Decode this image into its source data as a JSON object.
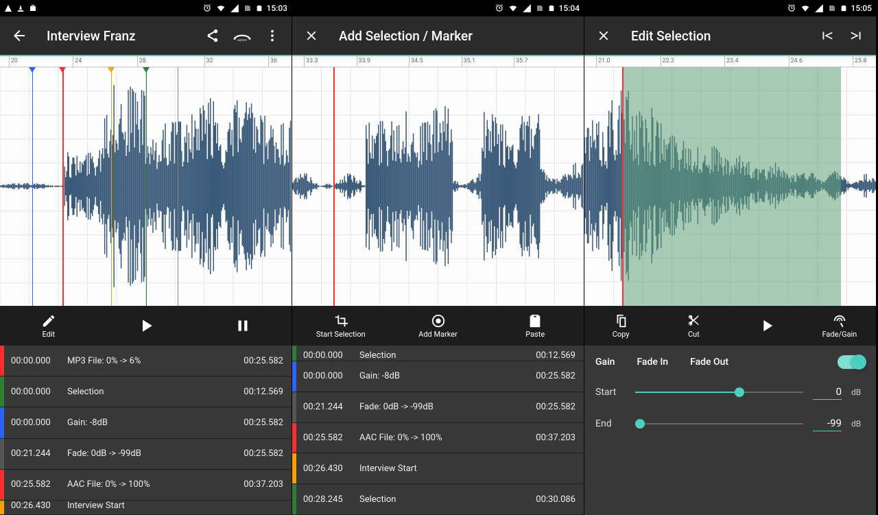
{
  "screens": [
    {
      "status": {
        "time": "15:03",
        "left_icons": [
          "antenna-icon",
          "vlc-icon",
          "bag-icon"
        ],
        "right_icons": [
          "alarm-icon",
          "wifi-icon",
          "signal-icon",
          "nosim-icon",
          "battery-icon"
        ]
      },
      "appbar": {
        "leading": "back-arrow",
        "title": "Interview Franz",
        "actions": [
          "share-icon",
          "auphonic-icon",
          "more-icon"
        ]
      },
      "ruler": {
        "ticks": [
          "20",
          "24",
          "28",
          "32",
          "36"
        ],
        "positions": [
          3,
          25,
          47,
          70,
          92
        ]
      },
      "waveform": {
        "playhead_pct": 21.5,
        "markers": [
          {
            "pct": 11,
            "color": "#2962ff"
          },
          {
            "pct": 21.5,
            "color": "#ff2d2d"
          },
          {
            "pct": 38,
            "color": "#ffa000"
          },
          {
            "pct": 50,
            "color": "#2e7d32"
          }
        ],
        "marker_lines": [
          {
            "pct": 11,
            "color": "#2962ff"
          },
          {
            "pct": 38,
            "color": "#ffa000"
          },
          {
            "pct": 50,
            "color": "#2e7d32"
          },
          {
            "pct": 61,
            "color": "#888"
          }
        ]
      },
      "toolbar": [
        {
          "icon": "pencil-icon",
          "label": "Edit",
          "name": "edit-button"
        },
        {
          "icon": "play-icon",
          "label": "",
          "name": "play-button"
        },
        {
          "icon": "pause-icon",
          "label": "",
          "name": "pause-button"
        }
      ],
      "list": [
        {
          "color": "#ff2d2d",
          "t1": "00:00.000",
          "desc": "MP3 File: 0% -> 6%",
          "t2": "00:25.582"
        },
        {
          "color": "#2e7d32",
          "t1": "00:00.000",
          "desc": "Selection",
          "t2": "00:12.569"
        },
        {
          "color": "#2962ff",
          "t1": "00:00.000",
          "desc": "Gain: -8dB",
          "t2": "00:25.582"
        },
        {
          "color": "#555",
          "t1": "00:21.244",
          "desc": "Fade: 0dB -> -99dB",
          "t2": "00:25.582"
        },
        {
          "color": "#ff2d2d",
          "t1": "00:25.582",
          "desc": "AAC File: 0% -> 100%",
          "t2": "00:37.203"
        }
      ],
      "list_partial_bottom": {
        "color": "#ffa000",
        "t1": "00:26.430",
        "desc": "Interview Start",
        "t2": ""
      }
    },
    {
      "status": {
        "time": "15:04",
        "left_icons": [],
        "right_icons": [
          "alarm-icon",
          "wifi-icon",
          "signal-icon",
          "nosim-icon",
          "battery-icon"
        ]
      },
      "appbar": {
        "leading": "close-x",
        "title": "Add Selection / Marker",
        "actions": []
      },
      "ruler": {
        "ticks": [
          "33.3",
          "33.9",
          "34.5",
          "35.1",
          "35.7"
        ],
        "positions": [
          4,
          22,
          40,
          58,
          76
        ]
      },
      "waveform": {
        "playhead_pct": 14,
        "markers": [],
        "marker_lines": []
      },
      "toolbar": [
        {
          "icon": "crop-icon",
          "label": "Start Selection",
          "name": "start-selection-button"
        },
        {
          "icon": "target-icon",
          "label": "Add Marker",
          "name": "add-marker-button"
        },
        {
          "icon": "clipboard-icon",
          "label": "Paste",
          "name": "paste-button"
        }
      ],
      "list_partial_top": {
        "color": "#2e7d32",
        "t1": "00:00.000",
        "desc": "Selection",
        "t2": "00:12.569"
      },
      "list": [
        {
          "color": "#2962ff",
          "t1": "00:00.000",
          "desc": "Gain: -8dB",
          "t2": "00:25.582"
        },
        {
          "color": "#555",
          "t1": "00:21.244",
          "desc": "Fade: 0dB -> -99dB",
          "t2": "00:25.582"
        },
        {
          "color": "#ff2d2d",
          "t1": "00:25.582",
          "desc": "AAC File: 0% -> 100%",
          "t2": "00:37.203"
        },
        {
          "color": "#ffa000",
          "t1": "00:26.430",
          "desc": "Interview Start",
          "t2": ""
        },
        {
          "color": "#2e7d32",
          "t1": "00:28.245",
          "desc": "Selection",
          "t2": "00:30.086"
        }
      ]
    },
    {
      "status": {
        "time": "15:05",
        "left_icons": [],
        "right_icons": [
          "alarm-icon",
          "wifi-icon",
          "signal-icon",
          "nosim-icon",
          "battery-icon"
        ]
      },
      "appbar": {
        "leading": "close-x",
        "title": "Edit Selection",
        "actions": [
          "seek-start-icon",
          "seek-end-icon"
        ]
      },
      "ruler": {
        "ticks": [
          "21.0",
          "22.2",
          "23.4",
          "24.6",
          "25.8"
        ],
        "positions": [
          4,
          26,
          48,
          70,
          92
        ]
      },
      "waveform": {
        "playhead_pct": 13,
        "selection": {
          "from_pct": 13,
          "to_pct": 88
        },
        "markers": [],
        "marker_lines": []
      },
      "toolbar": [
        {
          "icon": "copy-icon",
          "label": "Copy",
          "name": "copy-button"
        },
        {
          "icon": "cut-icon",
          "label": "Cut",
          "name": "cut-button"
        },
        {
          "icon": "play-icon",
          "label": "",
          "name": "play-button"
        },
        {
          "icon": "fadegain-icon",
          "label": "Fade/Gain",
          "name": "fade-gain-button"
        }
      ],
      "fadepanel": {
        "tabs": [
          "Gain",
          "Fade In",
          "Fade Out"
        ],
        "toggle_on": true,
        "sliders": [
          {
            "label": "Start",
            "value": "0",
            "unit": "dB",
            "pct": 62
          },
          {
            "label": "End",
            "value": "-99",
            "unit": "dB",
            "pct": 3
          }
        ]
      }
    }
  ]
}
